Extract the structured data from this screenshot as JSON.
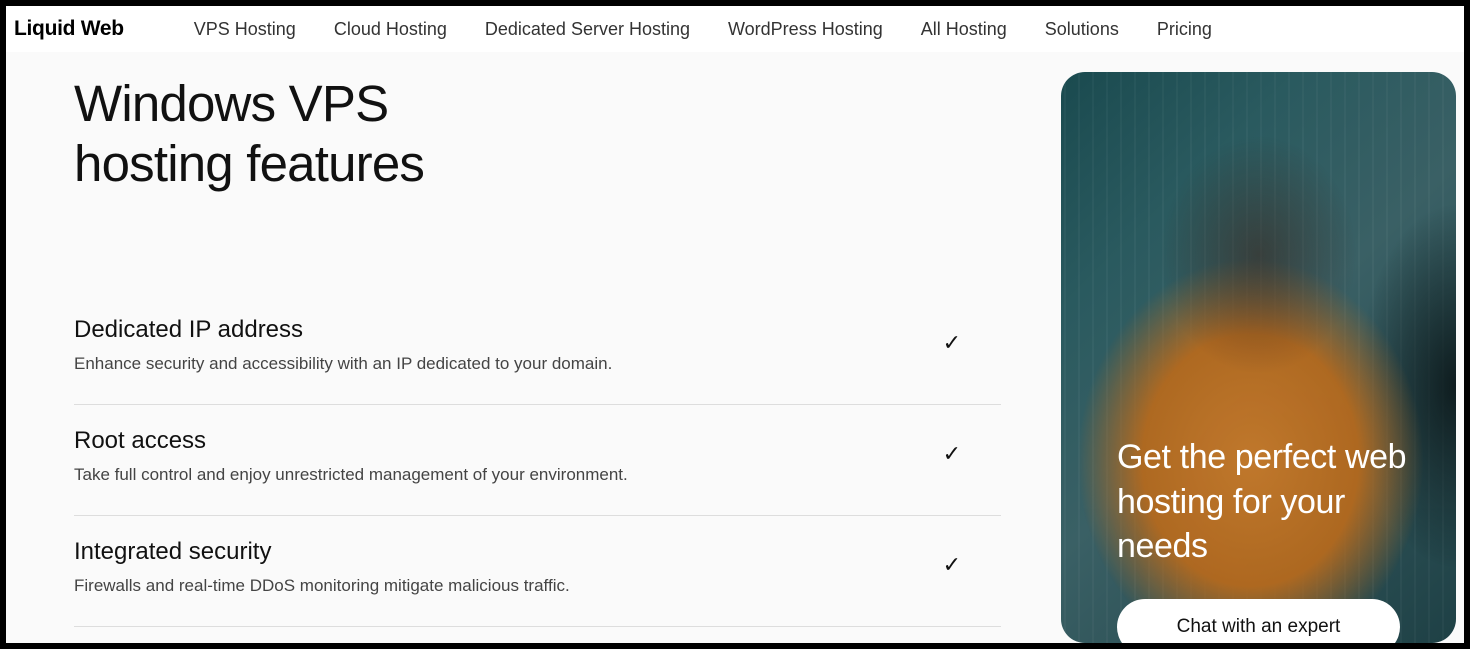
{
  "logo": "Liquid Web",
  "nav": [
    "VPS Hosting",
    "Cloud Hosting",
    "Dedicated Server Hosting",
    "WordPress Hosting",
    "All Hosting",
    "Solutions",
    "Pricing"
  ],
  "headline_line1": "Windows VPS",
  "headline_line2": "hosting features",
  "features": [
    {
      "title": "Dedicated IP address",
      "desc": "Enhance security and accessibility with an IP dedicated to your domain."
    },
    {
      "title": "Root access",
      "desc": "Take full control and enjoy unrestricted management of your environment."
    },
    {
      "title": "Integrated security",
      "desc": "Firewalls and real-time DDoS monitoring mitigate malicious traffic."
    }
  ],
  "check_glyph": "✓",
  "side": {
    "text": "Get the perfect web hosting for your needs",
    "button": "Chat with an expert"
  }
}
